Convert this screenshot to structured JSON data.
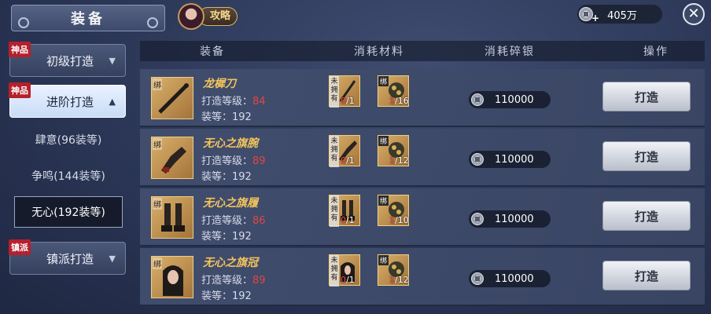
{
  "header": {
    "title": "装备",
    "strategy_label": "攻略",
    "money": "405万"
  },
  "sidebar": {
    "categories": [
      {
        "tag": "神品",
        "label": "初级打造"
      },
      {
        "tag": "神品",
        "label": "进阶打造"
      },
      {
        "tag": "镇派",
        "label": "镇派打造"
      }
    ],
    "subs": [
      "肆意(96装等)",
      "争鸣(144装等)",
      "无心(192装等)"
    ]
  },
  "table": {
    "columns": [
      "装备",
      "消耗材料",
      "消耗碎银",
      "操作"
    ],
    "rows": [
      {
        "name": "龙樨刀",
        "level_label": "打造等级：",
        "level": "84",
        "equip_label": "装等：",
        "equip": "192",
        "bind": "绑",
        "mat1_tag": "未拥有",
        "mat1_have": "0",
        "mat1_need": "/1",
        "mat2_tag": "绑",
        "mat2_have": "1",
        "mat2_need": "/16",
        "cost": "110000",
        "action": "打造"
      },
      {
        "name": "无心之旗腕",
        "level_label": "打造等级：",
        "level": "89",
        "equip_label": "装等：",
        "equip": "192",
        "bind": "绑",
        "mat1_tag": "未拥有",
        "mat1_have": "0",
        "mat1_need": "/1",
        "mat2_tag": "绑",
        "mat2_have": "1",
        "mat2_need": "/12",
        "cost": "110000",
        "action": "打造"
      },
      {
        "name": "无心之旗履",
        "level_label": "打造等级：",
        "level": "86",
        "equip_label": "装等：",
        "equip": "192",
        "bind": "绑",
        "mat1_tag": "未拥有",
        "mat1_have": "0",
        "mat1_need": "/1",
        "mat2_tag": "绑",
        "mat2_have": "1",
        "mat2_need": "/10",
        "cost": "110000",
        "action": "打造"
      },
      {
        "name": "无心之旗冠",
        "level_label": "打造等级：",
        "level": "89",
        "equip_label": "装等：",
        "equip": "192",
        "bind": "绑",
        "mat1_tag": "未拥有",
        "mat1_have": "0",
        "mat1_need": "/1",
        "mat2_tag": "绑",
        "mat2_have": "1",
        "mat2_need": "/12",
        "cost": "110000",
        "action": "打造"
      }
    ]
  },
  "icons": {
    "close": "close-icon",
    "coin": "silver-coin-icon",
    "avatar": "strategy-avatar"
  }
}
